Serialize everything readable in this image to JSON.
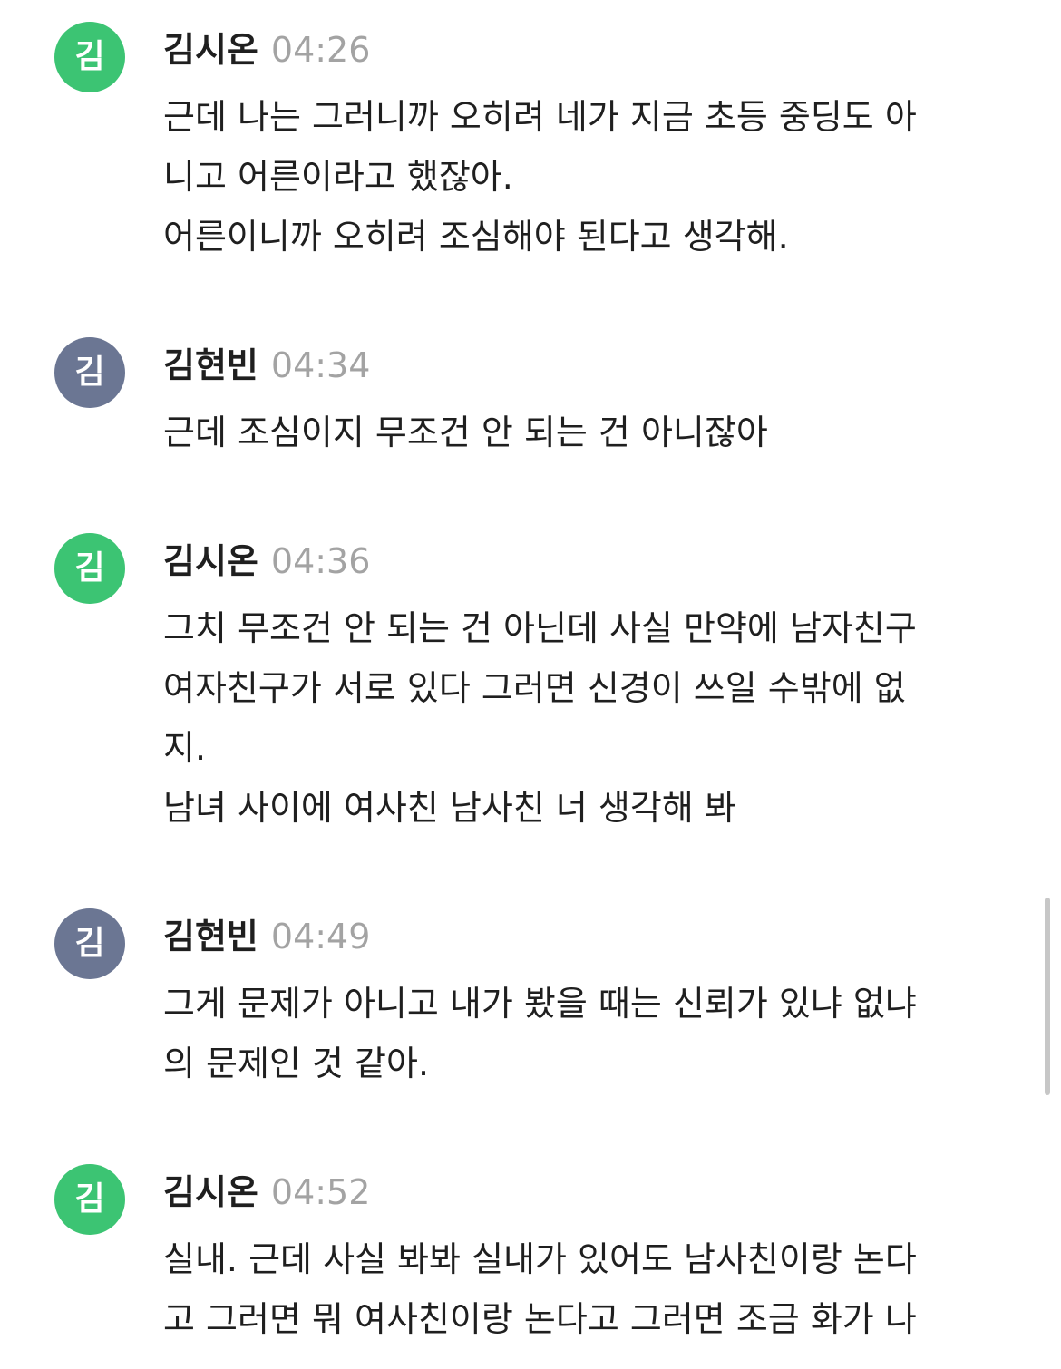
{
  "colors": {
    "avatar_siwon": "#3cc473",
    "avatar_hyeonbin": "#6b7693",
    "text": "#1f1f1f",
    "timestamp": "#a3a3a3",
    "scrollbar": "#c7c7c7"
  },
  "messages": [
    {
      "avatar": "김",
      "name": "김시온",
      "time": "04:26",
      "lines": [
        "근데 나는 그러니까 오히려 네가 지금 초등 중딩도 아",
        "니고 어른이라고 했잖아.",
        "어른이니까 오히려 조심해야 된다고 생각해."
      ]
    },
    {
      "avatar": "김",
      "name": "김현빈",
      "time": "04:34",
      "lines": [
        "근데 조심이지 무조건 안 되는 건 아니잖아"
      ]
    },
    {
      "avatar": "김",
      "name": "김시온",
      "time": "04:36",
      "lines": [
        "그치 무조건 안 되는 건 아닌데 사실 만약에 남자친구",
        "여자친구가 서로 있다 그러면 신경이 쓰일 수밖에 없",
        "지.",
        "남녀 사이에 여사친 남사친 너 생각해 봐"
      ]
    },
    {
      "avatar": "김",
      "name": "김현빈",
      "time": "04:49",
      "lines": [
        "그게 문제가 아니고 내가 봤을 때는 신뢰가 있냐 없냐",
        "의 문제인 것 같아."
      ]
    },
    {
      "avatar": "김",
      "name": "김시온",
      "time": "04:52",
      "lines": [
        "실내. 근데 사실 봐봐 실내가 있어도 남사친이랑 논다",
        "고 그러면 뭐 여사친이랑 논다고 그러면 조금 화가 나"
      ]
    }
  ]
}
